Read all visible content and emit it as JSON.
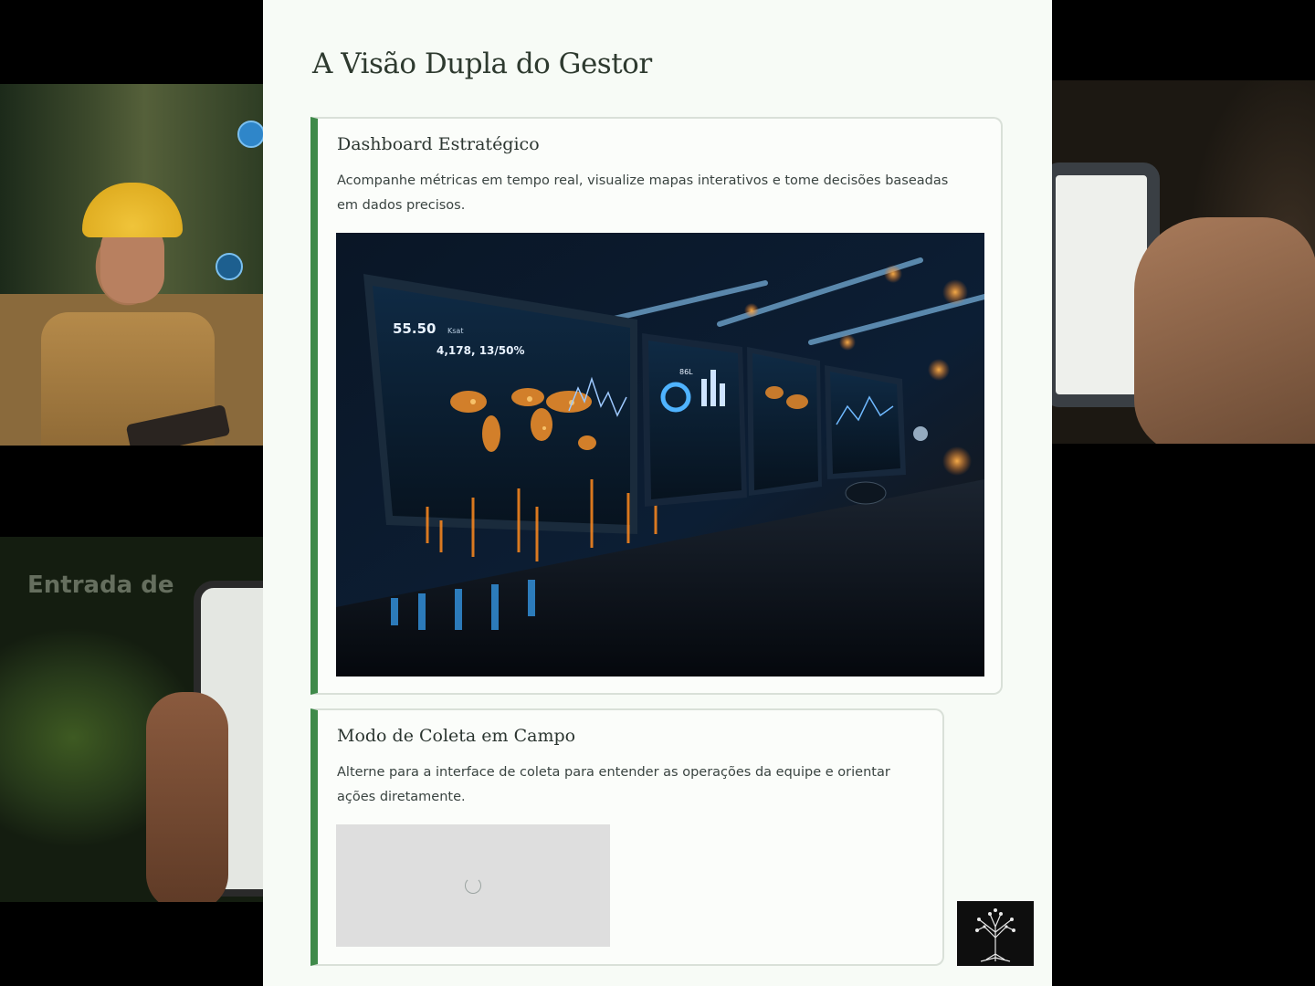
{
  "background": {
    "bottom_left_overlay_text": "Entrada de"
  },
  "page": {
    "title": "A Visão Dupla do Gestor"
  },
  "cards": [
    {
      "title": "Dashboard Estratégico",
      "description": "Acompanhe métricas em tempo real, visualize mapas interativos e tome decisões baseadas em dados precisos.",
      "image": {
        "readout_primary": "55.50",
        "readout_primary_suffix": "Ksat",
        "readout_secondary": "4,178, 13/50%",
        "readout_panel": "86L"
      }
    },
    {
      "title": "Modo de Coleta em Campo",
      "description": "Alterne para a interface de coleta para entender as operações da equipe e orientar ações diretamente."
    }
  ],
  "colors": {
    "accent_green": "#3f8a4a",
    "card_border": "#d9e0d8",
    "sheet_bg": "#f7fbf6"
  },
  "icons": [
    "tree-circuit-logo-icon",
    "loading-spinner-icon",
    "user-profile-icon"
  ]
}
